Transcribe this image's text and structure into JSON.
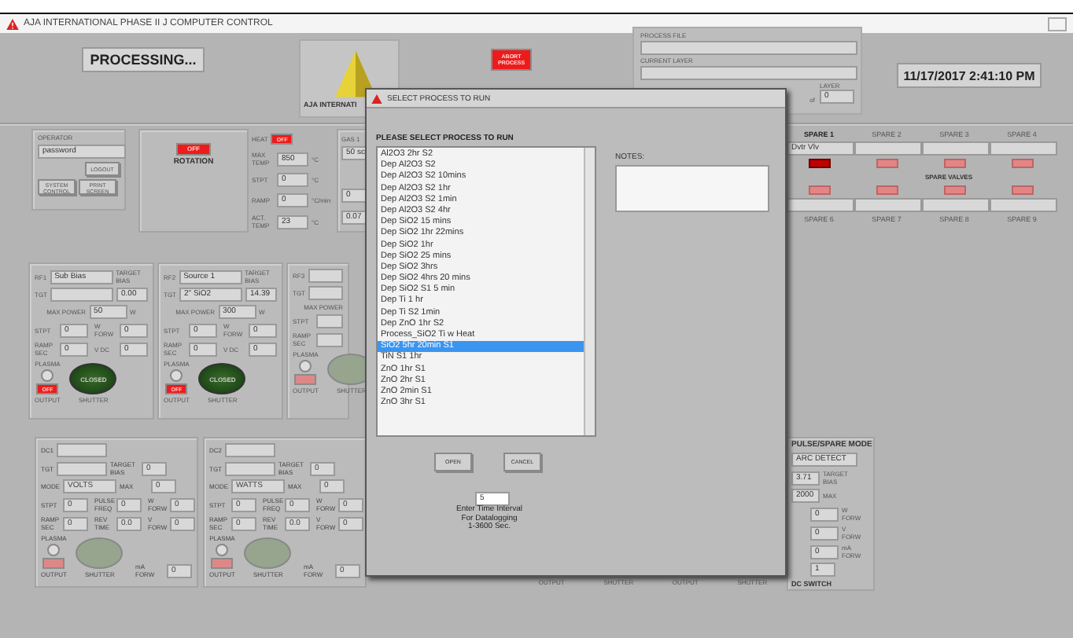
{
  "window": {
    "title": "AJA INTERNATIONAL PHASE II J COMPUTER CONTROL"
  },
  "status": {
    "text": "PROCESSING..."
  },
  "logo": {
    "text": "AJA INTERNATI"
  },
  "abort_button": {
    "label": "ABORT PROCESS"
  },
  "process_info": {
    "process_file_label": "PROCESS FILE",
    "current_layer_label": "CURRENT LAYER",
    "layer_label": "LAYER",
    "of_label": "of",
    "layer_total": "0"
  },
  "clock": "11/17/2017 2:41:10 PM",
  "spare_valves": {
    "label": "SPARE VALVES",
    "top": [
      {
        "name": "SPARE 1",
        "value": "Dvtr Vlv",
        "on": true
      },
      {
        "name": "SPARE 2",
        "on": false
      },
      {
        "name": "SPARE 3",
        "on": false
      },
      {
        "name": "SPARE 4",
        "on": false
      }
    ],
    "bottom": [
      {
        "name": "SPARE 6",
        "on": false
      },
      {
        "name": "SPARE 7",
        "on": false
      },
      {
        "name": "SPARE 8",
        "on": false
      },
      {
        "name": "SPARE 9",
        "on": false
      }
    ]
  },
  "operator": {
    "label": "OPERATOR",
    "value": "password",
    "logout": "LOGOUT",
    "buttons": [
      "SYSTEM CONTROL",
      "PRINT SCREEN"
    ]
  },
  "rotation": {
    "button": "OFF",
    "label": "ROTATION"
  },
  "heater": {
    "heat_label": "HEAT",
    "heat_button": "OFF",
    "rows": [
      {
        "label": "MAX TEMP",
        "value": "850",
        "unit": "°C"
      },
      {
        "label": "STPT",
        "value": "0",
        "unit": "°C"
      },
      {
        "label": "RAMP",
        "value": "0",
        "unit": "°C/min"
      },
      {
        "label": "ACT. TEMP",
        "value": "23",
        "unit": "°C"
      }
    ]
  },
  "gas": {
    "label": "GAS 1",
    "values": [
      "50 sc",
      "0",
      "0.07"
    ]
  },
  "rf_panels": [
    {
      "id_label": "RF1",
      "name": "Sub Bias",
      "tgt_label": "TGT",
      "target_label": "TARGET BIAS",
      "target": "0.00",
      "max_power_label": "MAX POWER",
      "max_power": "50",
      "unit": "W",
      "fields": [
        {
          "value": "0",
          "label": "STPT"
        },
        {
          "value": "0",
          "label": "W FORW"
        },
        {
          "value": "0",
          "label": "RAMP SEC"
        },
        {
          "value": "0",
          "label": "V DC"
        }
      ],
      "plasma_label": "PLASMA",
      "output": "OFF",
      "output_label": "OUTPUT",
      "shutter": "CLOSED",
      "shutter_label": "SHUTTER",
      "enabled": true
    },
    {
      "id_label": "RF2",
      "name": "Source 1",
      "tgt_label": "TGT",
      "tgt": "2\" SiO2",
      "target_label": "TARGET BIAS",
      "target": "14.39",
      "max_power_label": "MAX POWER",
      "max_power": "300",
      "unit": "W",
      "fields": [
        {
          "value": "0",
          "label": "STPT"
        },
        {
          "value": "0",
          "label": "W FORW"
        },
        {
          "value": "0",
          "label": "RAMP SEC"
        },
        {
          "value": "0",
          "label": "V DC"
        }
      ],
      "plasma_label": "PLASMA",
      "output": "OFF",
      "output_label": "OUTPUT",
      "shutter": "CLOSED",
      "shutter_label": "SHUTTER",
      "enabled": true
    }
  ],
  "rf3_panel": {
    "id_label": "RF3",
    "tgt_label": "TGT",
    "max_power_label": "MAX POWER",
    "fields": [
      {
        "label": "STPT"
      },
      {
        "label": "RAMP SEC"
      }
    ],
    "plasma_label": "PLASMA",
    "output_enabled": false,
    "output_label": "OUTPUT",
    "shutter_label": "SHUTTER"
  },
  "dc_panels": [
    {
      "id_label": "DC1",
      "tgt_label": "TGT",
      "target_label": "TARGET BIAS",
      "target": "0",
      "max_label": "MAX",
      "max": "0",
      "mode_label": "MODE",
      "mode": "VOLTS",
      "fields": [
        {
          "value": "0",
          "label": "STPT"
        },
        {
          "value": "0",
          "label": "PULSE FREQ"
        },
        {
          "value": "0",
          "label": "W FORW"
        },
        {
          "value": "0",
          "label": "RAMP SEC"
        },
        {
          "value": "0.0",
          "label": "REV TIME"
        },
        {
          "value": "0",
          "label": "V FORW"
        }
      ],
      "ma": {
        "value": "0",
        "label": "mA FORW"
      },
      "plasma_label": "PLASMA",
      "output_enabled": false,
      "output_label": "OUTPUT",
      "shutter_label": "SHUTTER"
    },
    {
      "id_label": "DC2",
      "tgt_label": "TGT",
      "target_label": "TARGET BIAS",
      "target": "0",
      "max_label": "MAX",
      "max": "0",
      "mode_label": "MODE",
      "mode": "WATTS",
      "fields": [
        {
          "value": "0",
          "label": "STPT"
        },
        {
          "value": "0",
          "label": "PULSE FREQ"
        },
        {
          "value": "0",
          "label": "W FORW"
        },
        {
          "value": "0",
          "label": "RAMP SEC"
        },
        {
          "value": "0.0",
          "label": "REV TIME"
        },
        {
          "value": "0",
          "label": "V FORW"
        }
      ],
      "ma": {
        "value": "0",
        "label": "mA FORW"
      },
      "plasma_label": "PLASMA",
      "output_enabled": false,
      "output_label": "OUTPUT",
      "shutter_label": "SHUTTER"
    }
  ],
  "below_dialog_labels": [
    "OUTPUT",
    "SHUTTER",
    "OUTPUT",
    "SHUTTER"
  ],
  "dc_right": {
    "mode_label": "PULSE/SPARE MODE",
    "mode": "ARC DETECT",
    "target": "3.71",
    "target_label": "TARGET BIAS",
    "max": "2000",
    "max_label": "MAX",
    "fields": [
      {
        "value": "0",
        "label": "W FORW"
      },
      {
        "value": "0",
        "label": "V FORW"
      },
      {
        "value": "0",
        "label": "mA FORW"
      }
    ],
    "switch": "1",
    "switch_label": "DC SWITCH"
  },
  "dialog": {
    "title": "SELECT PROCESS TO RUN",
    "prompt": "PLEASE SELECT PROCESS TO RUN",
    "notes_label": "NOTES:",
    "buttons": [
      "OPEN",
      "CANCEL"
    ],
    "interval": "5",
    "interval_hint": [
      "Enter Time Interval",
      "For Datalogging",
      "1-3600 Sec."
    ],
    "processes": [
      {
        "name": "Al2O3 2hr S2",
        "selected": false
      },
      {
        "name": "Dep Al2O3 S2",
        "selected": false
      },
      {
        "name": "Dep Al2O3 S2 10mins",
        "selected": false
      },
      {
        "name": "Dep Al2O3 S2 1hr",
        "selected": false
      },
      {
        "name": "Dep Al2O3 S2 1min",
        "selected": false
      },
      {
        "name": "Dep Al2O3 S2 4hr",
        "selected": false
      },
      {
        "name": "Dep SiO2 15 mins",
        "selected": false
      },
      {
        "name": "Dep SiO2 1hr 22mins",
        "selected": false
      },
      {
        "name": "Dep SiO2 1hr",
        "selected": false
      },
      {
        "name": "Dep SiO2 25 mins",
        "selected": false
      },
      {
        "name": "Dep SiO2 3hrs",
        "selected": false
      },
      {
        "name": "Dep SiO2 4hrs 20 mins",
        "selected": false
      },
      {
        "name": "Dep SiO2 S1 5 min",
        "selected": false
      },
      {
        "name": "Dep Ti 1 hr",
        "selected": false
      },
      {
        "name": "Dep Ti S2 1min",
        "selected": false
      },
      {
        "name": "Dep ZnO 1hr S2",
        "selected": false
      },
      {
        "name": "Process_SiO2 Ti w Heat",
        "selected": false
      },
      {
        "name": "SiO2 5hr 20min S1",
        "selected": true
      },
      {
        "name": "TiN S1 1hr",
        "selected": false
      },
      {
        "name": "ZnO 1hr S1",
        "selected": false
      },
      {
        "name": "ZnO 2hr S1",
        "selected": false
      },
      {
        "name": "ZnO 2min S1",
        "selected": false
      },
      {
        "name": "ZnO 3hr S1",
        "selected": false
      }
    ]
  }
}
